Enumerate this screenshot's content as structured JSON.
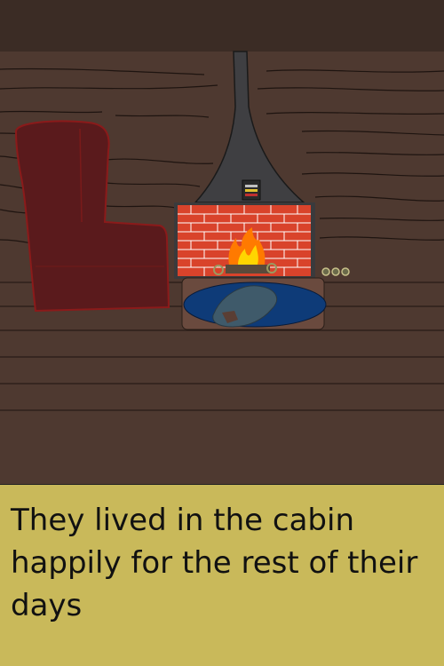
{
  "story": {
    "caption": "They lived in the cabin happily for the rest of their days"
  },
  "scene": {
    "objects": [
      "armchair",
      "stovepipe-chimney",
      "brick-fireplace",
      "fire",
      "rug",
      "bowls"
    ],
    "colors": {
      "ceiling": "#3b2c25",
      "wall": "#4e3930",
      "floor": "#4e3930",
      "armchair": "#5a1a1c",
      "armchair_outline": "#8b1a1a",
      "chimney": "#3f3f42",
      "brick": "#d9432b",
      "mortar": "#ffffff",
      "hearth": "#6a4a3e",
      "rug": "#0e3b78",
      "rug_stain": "#3f5a6a",
      "fire_outer": "#ff7a00",
      "fire_inner": "#ffd500",
      "caption_bg": "#c9b95a"
    }
  }
}
